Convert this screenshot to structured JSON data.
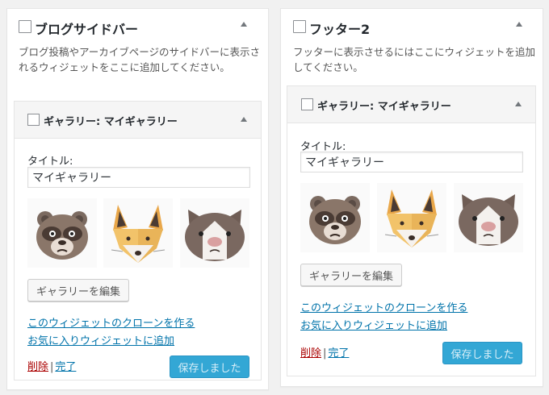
{
  "left_sidebar": {
    "title": "ブログサイドバー",
    "description": "ブログ投稿やアーカイブページのサイドバーに表示されるウィジェットをここに追加してください。",
    "widget": {
      "title": "ギャラリー: マイギャラリー",
      "title_label": "タイトル:",
      "title_value": "マイギャラリー",
      "images": [
        "raccoon-dog",
        "fox",
        "cat"
      ],
      "edit_gallery_label": "ギャラリーを編集",
      "clone_link": "このウィジェットのクローンを作る",
      "favorite_link": "お気に入りウィジェットに追加",
      "delete_link": "削除",
      "separator": "|",
      "done_link": "完了",
      "save_label": "保存しました"
    }
  },
  "right_sidebar": {
    "title": "フッター2",
    "description": "フッターに表示させるにはここにウィジェットを追加してください。",
    "widget": {
      "title": "ギャラリー: マイギャラリー",
      "title_label": "タイトル:",
      "title_value": "マイギャラリー",
      "images": [
        "raccoon-dog",
        "fox",
        "cat"
      ],
      "edit_gallery_label": "ギャラリーを編集",
      "clone_link": "このウィジェットのクローンを作る",
      "favorite_link": "お気に入りウィジェットに追加",
      "delete_link": "削除",
      "separator": "|",
      "done_link": "完了",
      "save_label": "保存しました"
    }
  },
  "colors": {
    "link": "#0073aa",
    "delete": "#aa0000",
    "save_button": "#33a7d5"
  }
}
